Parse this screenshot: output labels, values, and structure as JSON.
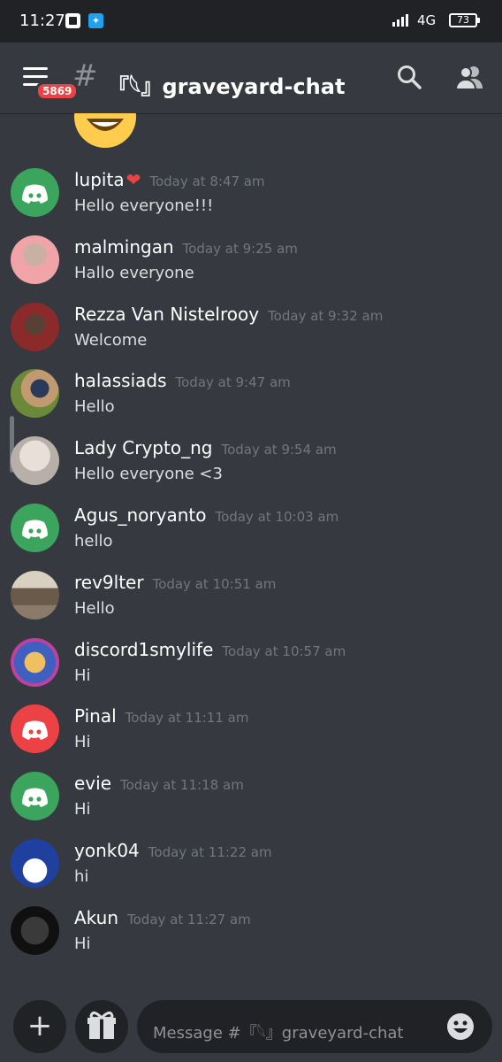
{
  "status_bar": {
    "time": "11:27",
    "network": "4G",
    "battery": "73",
    "icons": [
      "app-notification-icon",
      "twitter-icon",
      "signal-icon",
      "battery-icon"
    ]
  },
  "header": {
    "menu_badge": "5869",
    "hash": "#",
    "channel_name": "『𓆩』graveyard-chat",
    "icons": [
      "hamburger-icon",
      "search-icon",
      "members-icon"
    ]
  },
  "messages": [
    {
      "author": "lupita",
      "decoration": "❤",
      "time": "Today at 8:47 am",
      "text": "Hello everyone!!!",
      "avatar": "discord-green"
    },
    {
      "author": "malmingan",
      "time": "Today at 9:25 am",
      "text": "Hallo everyone",
      "avatar": "photo-pink"
    },
    {
      "author": "Rezza Van Nistelrooy",
      "time": "Today at 9:32 am",
      "text": "Welcome",
      "avatar": "photo-red"
    },
    {
      "author": "halassiads",
      "time": "Today at 9:47 am",
      "text": "Hello",
      "avatar": "photo-green"
    },
    {
      "author": "Lady Crypto_ng",
      "time": "Today at 9:54 am",
      "text": "Hello everyone <3",
      "avatar": "photo-light"
    },
    {
      "author": "Agus_noryanto",
      "time": "Today at 10:03 am",
      "text": "hello",
      "avatar": "discord-green"
    },
    {
      "author": "rev9lter",
      "time": "Today at 10:51 am",
      "text": "Hello",
      "avatar": "photo-street"
    },
    {
      "author": "discord1smylife",
      "time": "Today at 10:57 am",
      "text": "Hi",
      "avatar": "photo-colorful"
    },
    {
      "author": "Pinal",
      "time": "Today at 11:11 am",
      "text": "Hi",
      "avatar": "discord-red"
    },
    {
      "author": "evie",
      "time": "Today at 11:18 am",
      "text": "Hi",
      "avatar": "discord-green"
    },
    {
      "author": "yonk04",
      "time": "Today at 11:22 am",
      "text": "hi",
      "avatar": "cartoon-wizard"
    },
    {
      "author": "Akun",
      "time": "Today at 11:27 am",
      "text": "Hi",
      "avatar": "photo-cat"
    }
  ],
  "composer": {
    "add_label": "+",
    "placeholder": "Message #『𓆩』graveyard-chat",
    "icons": [
      "plus-icon",
      "gift-icon",
      "emoji-icon"
    ]
  },
  "colors": {
    "background": "#36393f",
    "status_bar": "#202225",
    "discord_green": "#3ba55d",
    "discord_red": "#ed4245",
    "timestamp": "#72767d"
  }
}
